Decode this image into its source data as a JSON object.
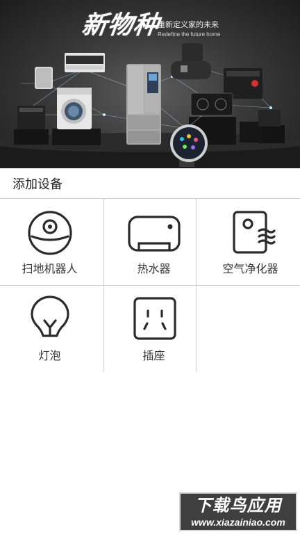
{
  "banner": {
    "title": "新物种",
    "subtitle_cn": "重新定义家的未来",
    "subtitle_en": "Redefine the future home"
  },
  "section": {
    "title": "添加设备"
  },
  "devices": [
    {
      "label": "扫地机器人",
      "icon": "robot-vacuum-icon"
    },
    {
      "label": "热水器",
      "icon": "water-heater-icon"
    },
    {
      "label": "空气净化器",
      "icon": "air-purifier-icon"
    },
    {
      "label": "灯泡",
      "icon": "light-bulb-icon"
    },
    {
      "label": "插座",
      "icon": "power-socket-icon"
    }
  ],
  "watermark": {
    "main": "下载鸟应用",
    "url": "www.xiazainiao.com"
  },
  "colors": {
    "icon_stroke": "#2b2b2b",
    "grid_line": "#cfcfcf",
    "banner_bg": "#3a3a3a",
    "text": "#333333"
  }
}
